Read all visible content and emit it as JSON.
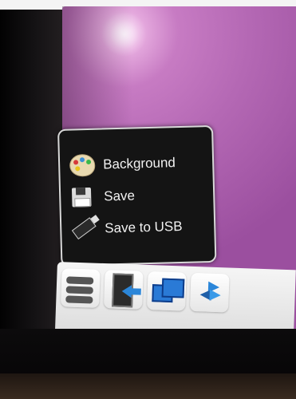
{
  "menu": {
    "items": [
      {
        "label": "Background",
        "icon": "palette-icon"
      },
      {
        "label": "Save",
        "icon": "floppy-disk-icon"
      },
      {
        "label": "Save to USB",
        "icon": "usb-drive-icon"
      }
    ]
  },
  "taskbar": {
    "buttons": [
      {
        "icon": "menu-icon"
      },
      {
        "icon": "exit-icon"
      },
      {
        "icon": "windows-icon"
      },
      {
        "icon": "share-arrows-icon"
      }
    ]
  },
  "colors": {
    "screen": "#b468b4",
    "popup": "#141414",
    "accent_blue": "#2b86d9"
  }
}
